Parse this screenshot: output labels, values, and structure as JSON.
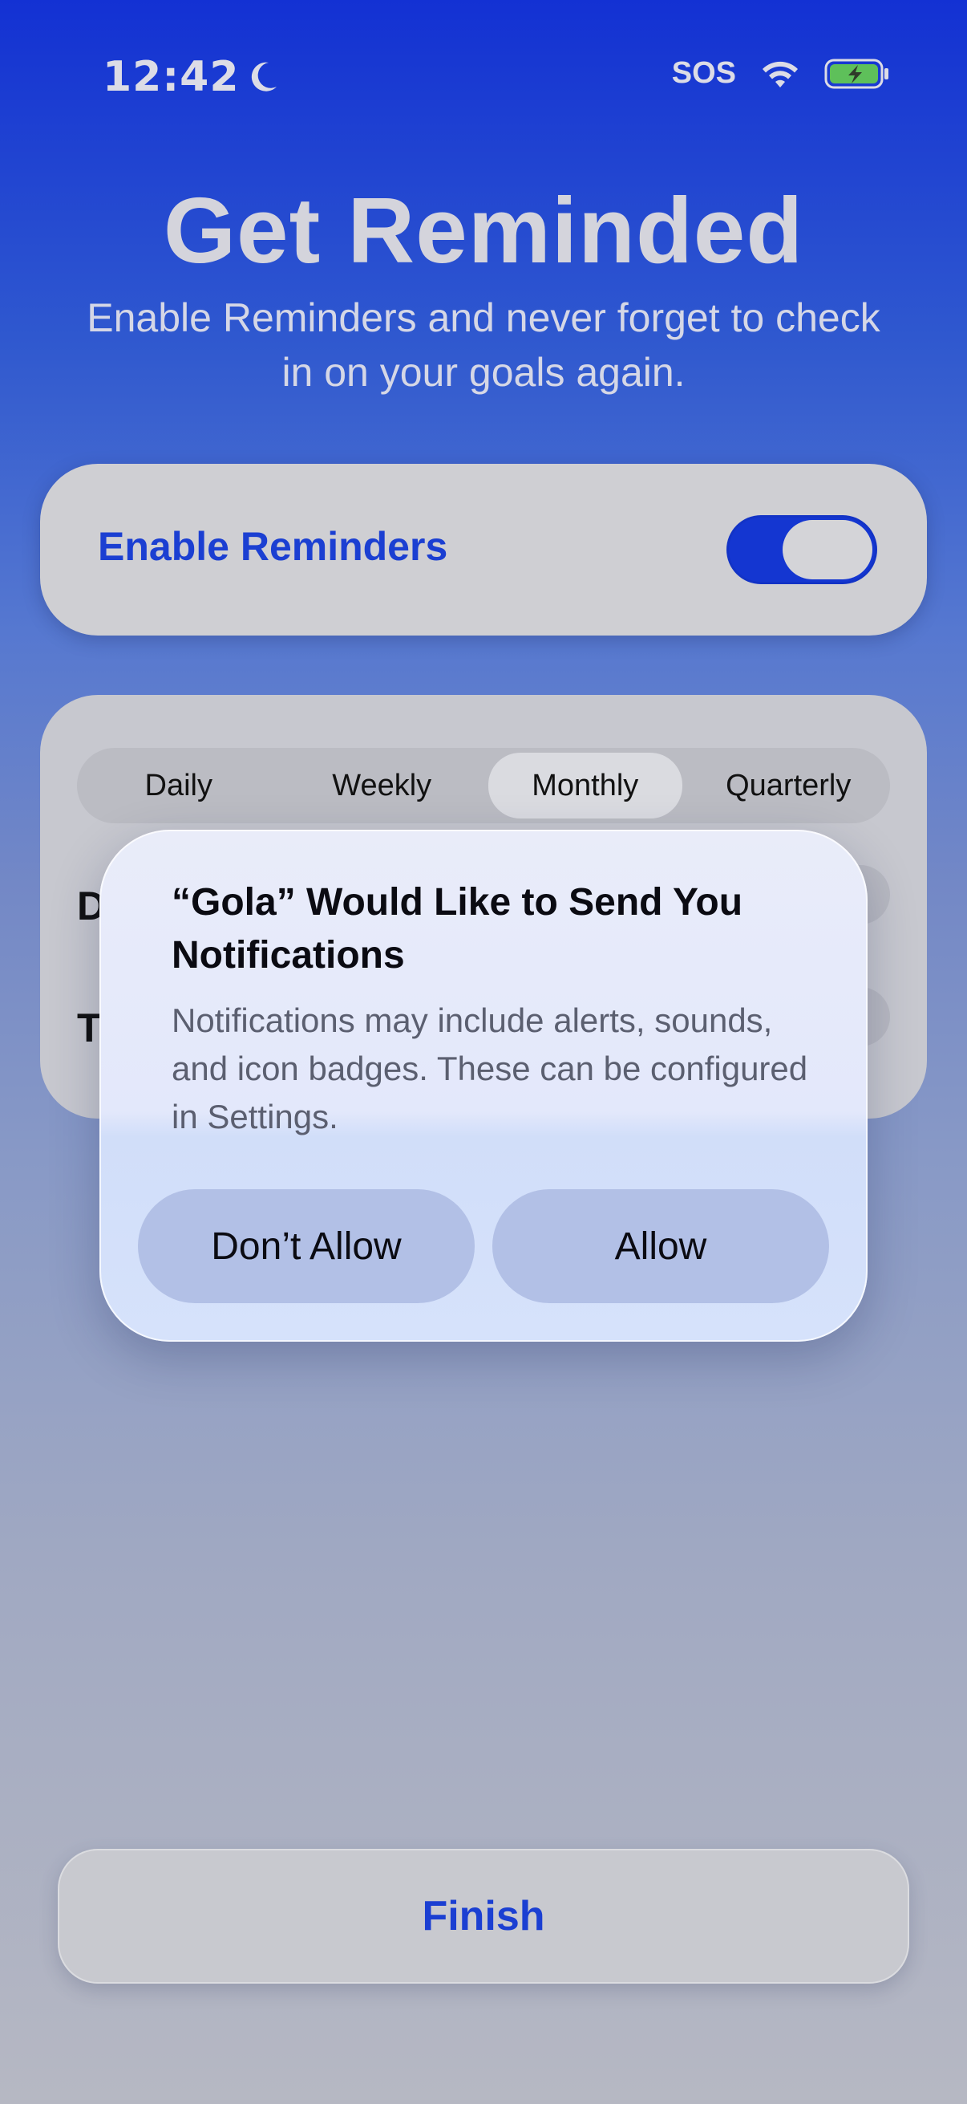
{
  "status_bar": {
    "time": "12:42",
    "carrier": "SOS",
    "icons": [
      "moon-icon",
      "wifi-icon",
      "battery-charging-icon"
    ],
    "battery_color": "#5ec05a"
  },
  "header": {
    "title": "Get Reminded",
    "subtitle": "Enable Reminders and never forget to check in on your goals again."
  },
  "reminders": {
    "label": "Enable Reminders",
    "enabled": true,
    "toggle_color": "#1436d1"
  },
  "schedule": {
    "frequency_options": [
      "Daily",
      "Weekly",
      "Monthly",
      "Quarterly"
    ],
    "selected": "Monthly",
    "rows": [
      {
        "label": "D"
      },
      {
        "label": "T"
      }
    ]
  },
  "alert": {
    "title": "“Gola” Would Like to Send You Notifications",
    "message": "Notifications may include alerts, sounds, and icon badges. These can be configured in Settings.",
    "deny_label": "Don’t Allow",
    "allow_label": "Allow"
  },
  "footer": {
    "finish_label": "Finish"
  },
  "colors": {
    "accent": "#1b3fd2"
  }
}
